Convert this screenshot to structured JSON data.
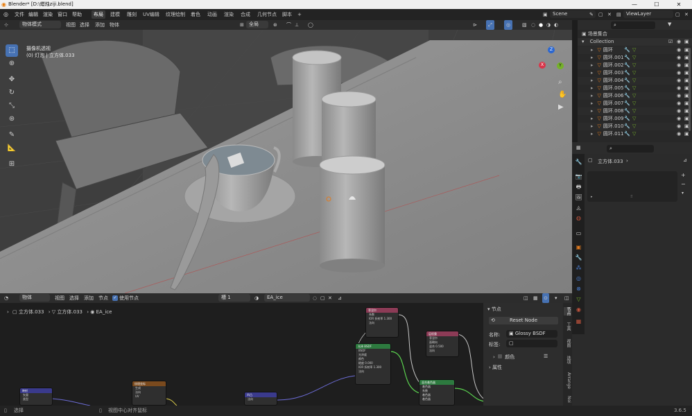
{
  "window": {
    "title": "Blender* [D:\\蜡烛ziji.blend]",
    "minimize": "—",
    "maximize": "☐",
    "close": "✕"
  },
  "menus": [
    "文件",
    "编辑",
    "渲染",
    "窗口",
    "帮助"
  ],
  "workspaces": [
    "布局",
    "建模",
    "雕刻",
    "UV编辑",
    "纹理绘制",
    "着色",
    "动画",
    "渲染",
    "合成",
    "几何节点",
    "脚本",
    "+"
  ],
  "scene": {
    "name": "Scene",
    "view_layer": "ViewLayer"
  },
  "viewport_header": {
    "mode": "物体模式",
    "menus": [
      "视图",
      "选择",
      "添加",
      "物体"
    ],
    "transform_orientation": "全局",
    "overlay_label": "透视",
    "search_placeholder": ""
  },
  "viewport": {
    "view_name": "摄像机透视",
    "object_info": "(0) 灯泡 | 立方体.033",
    "gizmo_axes": [
      "X",
      "Y",
      "Z"
    ]
  },
  "outliner": {
    "root": "场景集合",
    "collection": "Collection",
    "items": [
      "圆环",
      "圆环.001",
      "圆环.002",
      "圆环.003",
      "圆环.004",
      "圆环.005",
      "圆环.006",
      "圆环.007",
      "圆环.008",
      "圆环.009",
      "圆环.010",
      "圆环.011"
    ]
  },
  "properties": {
    "object": "立方体.033",
    "expand_glyph": "▸",
    "handle_glyph": "⠿"
  },
  "node_header": {
    "editor": "物体",
    "menus": [
      "视图",
      "选择",
      "添加",
      "节点"
    ],
    "use_nodes_label": "使用节点",
    "slot": "槽 1",
    "material": "EA_ice"
  },
  "node_breadcrumb": [
    "立方体.033",
    "立方体.033",
    "EA_ice"
  ],
  "nodes": [
    {
      "id": "n1",
      "title": "菲涅尔",
      "color": "#8c3b56",
      "lines": [
        "系数",
        "IOR 折射率 1.300",
        "法向"
      ]
    },
    {
      "id": "n2",
      "title": "光泽 BSDF",
      "color": "#2d7a3f",
      "lines": [
        "BSDF",
        "光泽度",
        "颜色",
        "糙度 0.000",
        "IOR 折射率 1.300",
        "法向"
      ]
    },
    {
      "id": "n3",
      "title": "层权重",
      "color": "#8c3b56",
      "lines": [
        "菲涅尔",
        "面朝向",
        "混合 0.500",
        "法向"
      ]
    },
    {
      "id": "n4",
      "title": "混合着色器",
      "color": "#2d7a3f",
      "lines": [
        "着色器",
        "系数",
        "着色器",
        "着色器"
      ]
    },
    {
      "id": "n5",
      "title": "纹理坐标",
      "color": "#7a4a1e",
      "lines": [
        "生成",
        "法向",
        "UV"
      ]
    },
    {
      "id": "n6",
      "title": "映射",
      "color": "#3a3a8c",
      "lines": [
        "矢量",
        "类型"
      ]
    },
    {
      "id": "n7",
      "title": "凹凸",
      "color": "#3a3a8c",
      "lines": [
        "法向"
      ]
    }
  ],
  "node_panel": {
    "section": "节点",
    "reset_button": "Reset Node",
    "name_label": "名称:",
    "name_value": "Glossy BSDF",
    "label_label": "标签:",
    "label_value": "",
    "color_label": "颜色",
    "properties_label": "属性",
    "tabs": [
      "节点",
      "工具",
      "视图",
      "选项",
      "Arrange",
      "Noi"
    ]
  },
  "status": {
    "select": "选择",
    "center_view": "视图中心对齐鼠标",
    "version": "3.6.5"
  },
  "colors": {
    "accent": "#4772b3",
    "viewport_bg": "#3d3d3d",
    "header": "#2c2c2c",
    "selected_object": "#e07a1f"
  }
}
